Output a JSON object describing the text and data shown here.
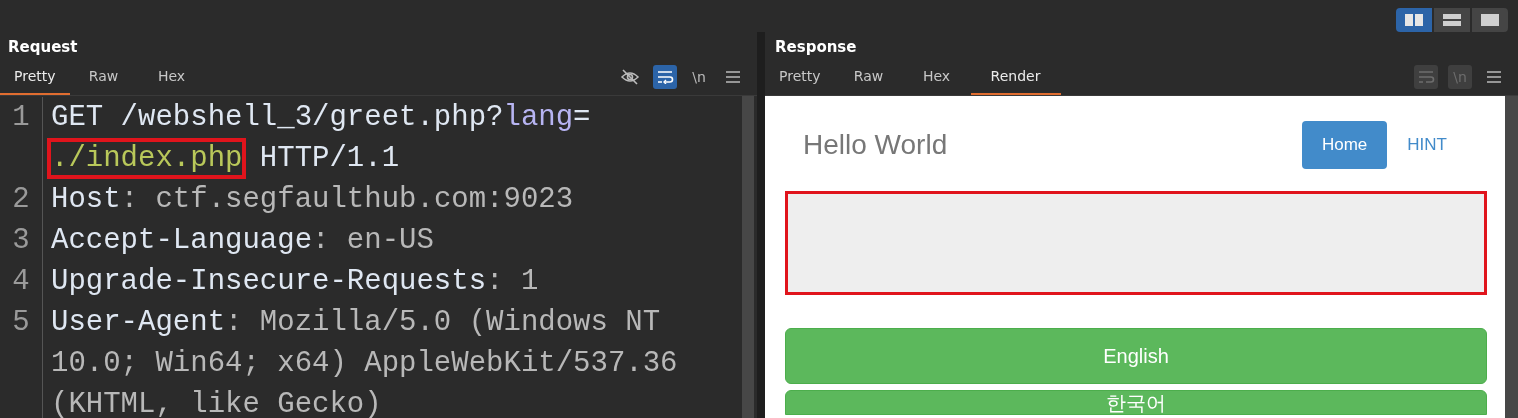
{
  "layout_toggles": [
    {
      "kind": "side-by-side",
      "selected": true
    },
    {
      "kind": "stacked",
      "selected": false
    },
    {
      "kind": "single",
      "selected": false
    }
  ],
  "request": {
    "title": "Request",
    "tabs": [
      {
        "label": "Pretty",
        "selected": true
      },
      {
        "label": "Raw",
        "selected": false
      },
      {
        "label": "Hex",
        "selected": false
      }
    ],
    "tools": [
      {
        "kind": "hide",
        "on": false
      },
      {
        "kind": "wrap",
        "on": true
      },
      {
        "kind": "newline",
        "label": "\\n",
        "on": false
      },
      {
        "kind": "menu",
        "on": false
      }
    ],
    "lines": [
      {
        "number": "1",
        "rows": [
          {
            "parts": [
              {
                "text": "GET /webshell_3/greet.php?",
                "kind": "plain",
                "highlighted": false
              },
              {
                "text": "lang",
                "kind": "param-name",
                "highlighted": false
              },
              {
                "text": "=",
                "kind": "plain",
                "highlighted": false
              }
            ]
          },
          {
            "parts": [
              {
                "text": "./index.php",
                "kind": "param-value",
                "highlighted": true
              },
              {
                "text": " HTTP/1.1",
                "kind": "plain",
                "highlighted": false
              }
            ]
          }
        ]
      },
      {
        "number": "2",
        "rows": [
          {
            "parts": [
              {
                "text": "Host",
                "kind": "header-name",
                "highlighted": false
              },
              {
                "text": ": ctf.segfaulthub.com:9023",
                "kind": "header-value",
                "highlighted": false
              }
            ]
          }
        ]
      },
      {
        "number": "3",
        "rows": [
          {
            "parts": [
              {
                "text": "Accept-Language",
                "kind": "header-name",
                "highlighted": false
              },
              {
                "text": ": en-US",
                "kind": "header-value",
                "highlighted": false
              }
            ]
          }
        ]
      },
      {
        "number": "4",
        "rows": [
          {
            "parts": [
              {
                "text": "Upgrade-Insecure-Requests",
                "kind": "header-name",
                "highlighted": false
              },
              {
                "text": ": 1",
                "kind": "header-value",
                "highlighted": false
              }
            ]
          }
        ]
      },
      {
        "number": "5",
        "rows": [
          {
            "parts": [
              {
                "text": "User-Agent",
                "kind": "header-name",
                "highlighted": false
              },
              {
                "text": ": Mozilla/5.0 (Windows NT",
                "kind": "header-value",
                "highlighted": false
              }
            ]
          },
          {
            "parts": [
              {
                "text": "10.0; Win64; x64) AppleWebKit/537.36",
                "kind": "header-value",
                "highlighted": false
              }
            ]
          },
          {
            "parts": [
              {
                "text": "(KHTML, like Gecko)",
                "kind": "header-value",
                "highlighted": false
              }
            ]
          }
        ]
      }
    ]
  },
  "response": {
    "title": "Response",
    "tabs": [
      {
        "label": "Pretty",
        "selected": false
      },
      {
        "label": "Raw",
        "selected": false
      },
      {
        "label": "Hex",
        "selected": false
      },
      {
        "label": "Render",
        "selected": true
      }
    ],
    "tools": [
      {
        "kind": "wrap",
        "disabled": true
      },
      {
        "kind": "newline",
        "label": "\\n",
        "disabled": true
      },
      {
        "kind": "menu",
        "disabled": false
      }
    ],
    "render": {
      "brand": "Hello World",
      "nav": [
        {
          "label": "Home",
          "selected": true
        },
        {
          "label": "HINT",
          "selected": false
        }
      ],
      "panel": {
        "highlighted": true
      },
      "buttons": [
        "English",
        "한국어"
      ]
    }
  }
}
